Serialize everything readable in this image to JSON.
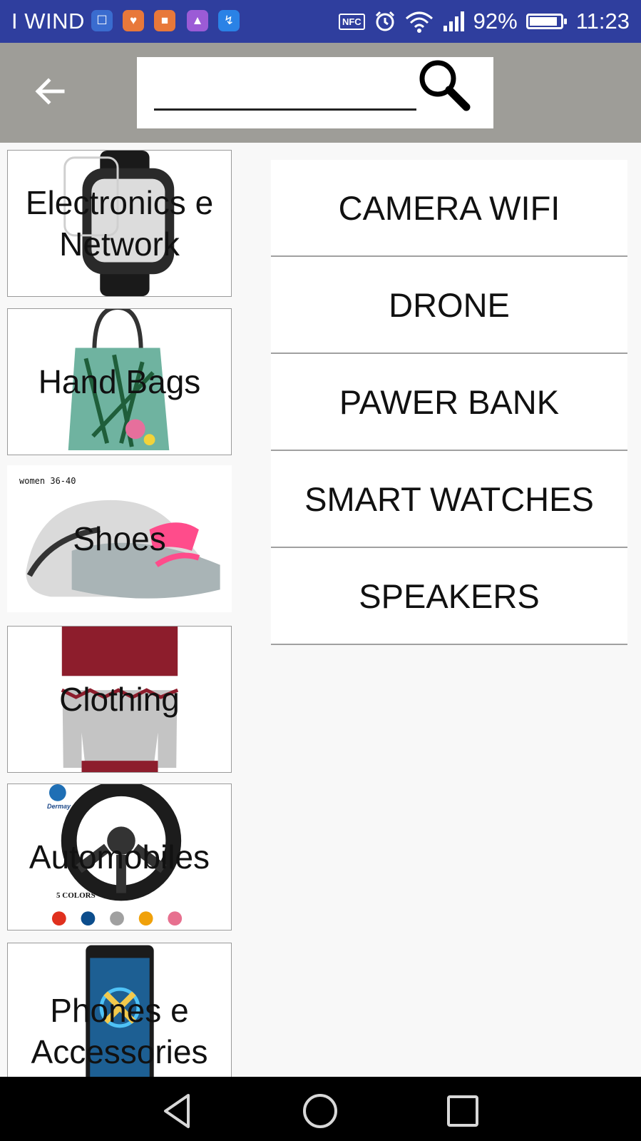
{
  "status_bar": {
    "carrier": "I WIND",
    "nfc": "NFC",
    "battery_percent": "92%",
    "battery_level": 0.92,
    "time": "11:23",
    "notification_icons": [
      "lock-icon",
      "health-icon",
      "message-icon",
      "gallery-icon",
      "messenger-icon"
    ]
  },
  "toolbar": {
    "search_value": "",
    "search_placeholder": ""
  },
  "categories": [
    {
      "label": "Electronics e Network",
      "image": "smartwatch"
    },
    {
      "label": "Hand Bags",
      "image": "handbag"
    },
    {
      "label": "Shoes",
      "image": "sneaker",
      "image_caption": "women 36-40"
    },
    {
      "label": "Clothing",
      "image": "sweater"
    },
    {
      "label": "Automobiles",
      "image": "steering-wheel-cover",
      "image_brand": "Dermay",
      "image_caption": "5 COLORS"
    },
    {
      "label": "Phones e Accessories",
      "image": "smartphone"
    }
  ],
  "subcategories": [
    "CAMERA WIFI",
    "DRONE",
    "PAWER BANK",
    "SMART WATCHES",
    "SPEAKERS"
  ],
  "colors": {
    "status_bar": "#2f3e9e",
    "toolbar": "#9e9d98",
    "background": "#f8f8f8",
    "navbar": "#000000"
  }
}
